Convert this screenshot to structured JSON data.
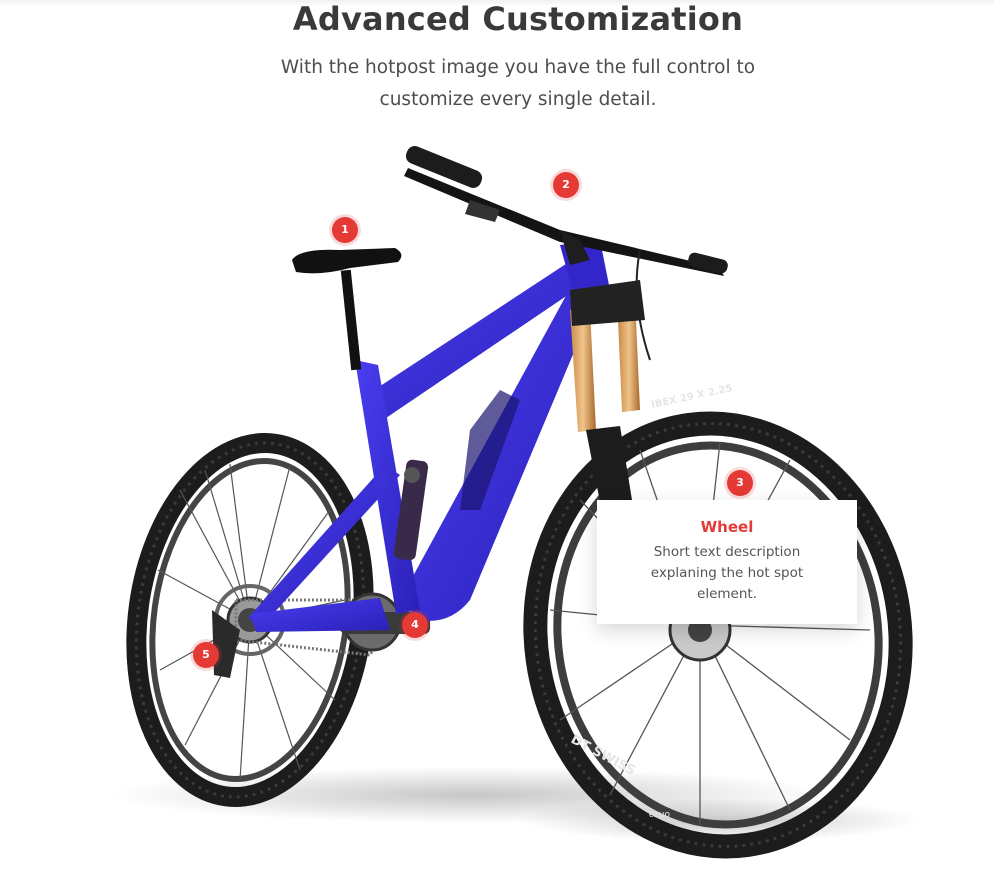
{
  "header": {
    "title": "Advanced Customization",
    "subtitle": "With the hotpost image you have the full control to customize every single detail."
  },
  "colors": {
    "accent": "#e53935",
    "frame": "#3b2fd6",
    "tire": "#1c1c1c"
  },
  "bike": {
    "tire_text_front": "IBEX 29 X 2.25",
    "rim_text": "DT SWISS",
    "hub_text": "onza"
  },
  "hotspots": [
    {
      "number": "1"
    },
    {
      "number": "2"
    },
    {
      "number": "3"
    },
    {
      "number": "4"
    },
    {
      "number": "5"
    }
  ],
  "tooltip": {
    "title": "Wheel",
    "text": "Short text description explaning the hot spot element."
  }
}
